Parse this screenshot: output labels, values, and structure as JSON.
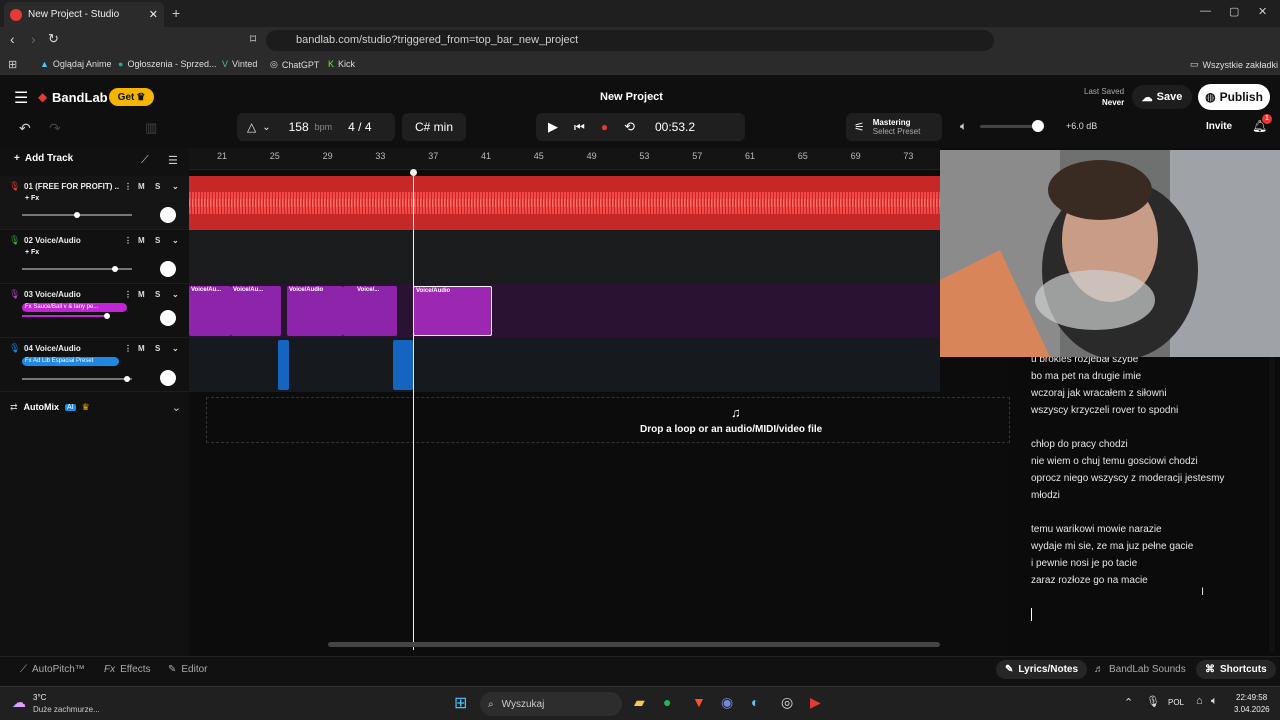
{
  "browser": {
    "tab_title": "New Project - Studio",
    "url": "bandlab.com/studio?triggered_from=top_bar_new_project",
    "bookmarks": [
      "Oglądaj Anime",
      "Ogłoszenia - Sprzed...",
      "Vinted",
      "ChatGPT",
      "Kick"
    ],
    "bookmarks_all": "Wszystkie zakładki"
  },
  "studio": {
    "logo": "BandLab",
    "get_label": "Get",
    "project_title": "New Project",
    "last_saved_label": "Last Saved",
    "last_saved_value": "Never",
    "save_label": "Save",
    "publish_label": "Publish",
    "invite_label": "Invite",
    "notif_count": "1",
    "bpm_value": "158",
    "bpm_unit": "bpm",
    "time_sig": "4 / 4",
    "key": "C# min",
    "time": "00:53.2",
    "mastering_label": "Mastering",
    "mastering_preset": "Select Preset",
    "volume_db": "+6.0 dB",
    "add_track": "Add Track",
    "ruler_marks": [
      "21",
      "25",
      "29",
      "33",
      "37",
      "41",
      "45",
      "49",
      "53",
      "57",
      "61",
      "65",
      "69",
      "73"
    ],
    "tracks": [
      {
        "name": "01  (FREE FOR PROFIT) ...",
        "fx": "+ Fx",
        "mute": "M",
        "solo": "S"
      },
      {
        "name": "02  Voice/Audio",
        "fx": "+ Fx",
        "mute": "M",
        "solo": "S"
      },
      {
        "name": "03  Voice/Audio",
        "fx": "Fx Sauce/Ball v & lany pe...",
        "mute": "M",
        "solo": "S"
      },
      {
        "name": "04  Voice/Audio",
        "fx": "Fx Ad Lib Espacial Preset",
        "mute": "M",
        "solo": "S"
      }
    ],
    "clips": [
      "Voice/Au...",
      "Voice/Au...",
      "Voice/Audio",
      "Voice/...",
      "Voice/Audio"
    ],
    "automix_label": "AutoMix",
    "ai_badge": "AI",
    "drop_text": "Drop a loop or an audio/MIDI/video file"
  },
  "lyrics": [
    "u brokies rozjebał szybe",
    "bo ma pet na drugie imie",
    "wczoraj jak wracałem z siłowni",
    "wszyscy krzyczeli rover to spodni",
    "",
    "chłop do pracy chodzi",
    "nie wiem o chuj temu gosciowi chodzi",
    "oprocz niego wszyscy z moderacji jestesmy",
    "młodzi",
    "",
    "temu warikowi mowie narazie",
    "wydaje mi sie, ze ma juz pełne gacie",
    "i pewnie nosi je po tacie",
    "zaraz rozłoze go na macie"
  ],
  "bottom": {
    "autopitch": "AutoPitch™",
    "effects": "Effects",
    "editor": "Editor",
    "lyrics_notes": "Lyrics/Notes",
    "sounds": "BandLab Sounds",
    "shortcuts": "Shortcuts"
  },
  "taskbar": {
    "weather_temp": "3°C",
    "weather_desc": "Duże zachmurze...",
    "search": "Wyszukaj",
    "lang": "POL",
    "time": "22:49:58",
    "date": "3.04.2026"
  },
  "colors": {
    "track1": "#e02020",
    "track3": "#7b1fa2",
    "track4": "#1e88e5",
    "accent": "#f5b400"
  }
}
